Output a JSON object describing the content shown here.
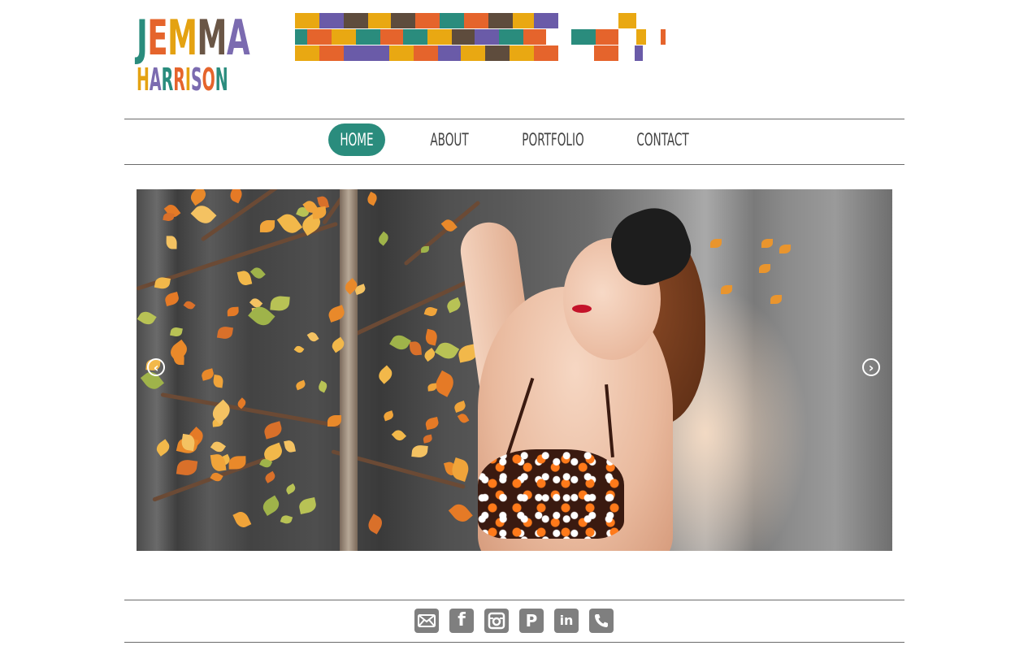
{
  "header": {
    "logo": {
      "line1": [
        "J",
        "E",
        "M",
        "M",
        "A"
      ],
      "line2": [
        "H",
        "A",
        "R",
        "R",
        "I",
        "S",
        "O",
        "N"
      ],
      "line1_colors": [
        "#2a8c7d",
        "#e5642c",
        "#e4a212",
        "#6a5646",
        "#7b6bb0"
      ],
      "line2_colors": [
        "#e4a212",
        "#7b6bb0",
        "#2a8c7d",
        "#e5642c",
        "#e4a212",
        "#7b6bb0",
        "#e5642c",
        "#2a8c7d"
      ]
    },
    "mosaic_colors": {
      "yellow": "#e9a812",
      "purple": "#6a5ba8",
      "brown": "#5e4c3d",
      "orange": "#e5642c",
      "teal": "#2a8c7d"
    }
  },
  "nav": {
    "items": [
      {
        "label": "HOME",
        "active": true
      },
      {
        "label": "ABOUT",
        "active": false
      },
      {
        "label": "PORTFOLIO",
        "active": false
      },
      {
        "label": "CONTACT",
        "active": false
      }
    ],
    "accent": "#2a8c7d"
  },
  "slider": {
    "prev_icon": "chevron-left-icon",
    "next_icon": "chevron-right-icon",
    "prev_glyph": "‹",
    "next_glyph": "›"
  },
  "social": {
    "color": "#7f7f7f",
    "icons": [
      "email-icon",
      "facebook-icon",
      "instagram-icon",
      "pinterest-icon",
      "linkedin-icon",
      "phone-icon"
    ],
    "glyphs": [
      "",
      "f",
      "",
      "P",
      "in",
      ""
    ]
  }
}
